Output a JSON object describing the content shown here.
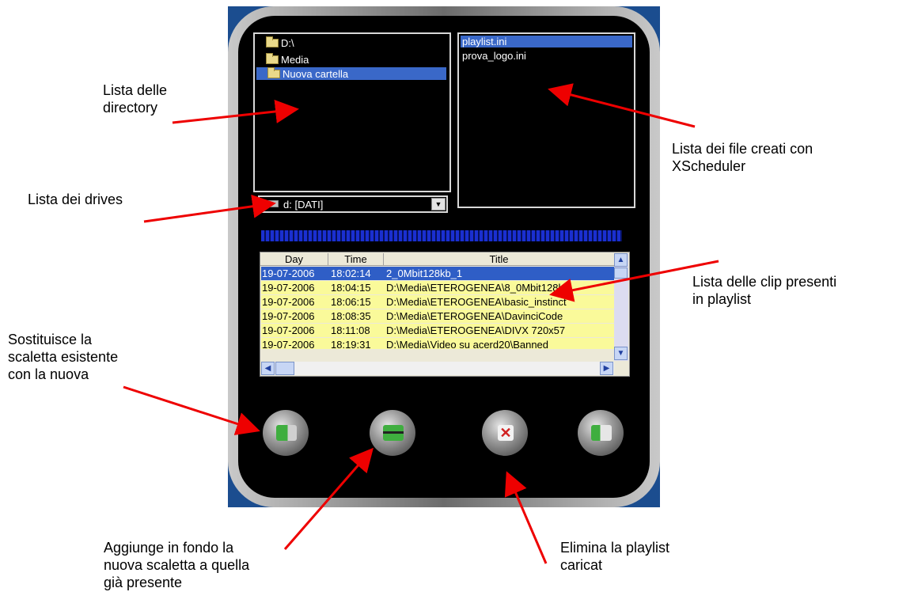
{
  "tree": {
    "items": [
      {
        "label": "D:\\",
        "selected": false
      },
      {
        "label": "Media",
        "selected": false
      },
      {
        "label": "Nuova cartella",
        "selected": true
      }
    ]
  },
  "files": {
    "items": [
      {
        "label": "playlist.ini",
        "selected": true
      },
      {
        "label": "prova_logo.ini",
        "selected": false
      }
    ]
  },
  "drive": {
    "value": "d: [DATI]"
  },
  "table": {
    "columns": [
      "Day",
      "Time",
      "Title"
    ],
    "rows": [
      [
        "19-07-2006",
        "18:02:14",
        "2_0Mbit128kb_1"
      ],
      [
        "19-07-2006",
        "18:04:15",
        "D:\\Media\\ETEROGENEA\\8_0Mbit128k"
      ],
      [
        "19-07-2006",
        "18:06:15",
        "D:\\Media\\ETEROGENEA\\basic_instinct"
      ],
      [
        "19-07-2006",
        "18:08:35",
        "D:\\Media\\ETEROGENEA\\DavinciCode"
      ],
      [
        "19-07-2006",
        "18:11:08",
        "D:\\Media\\ETEROGENEA\\DIVX 720x57"
      ],
      [
        "19-07-2006",
        "18:19:31",
        "D:\\Media\\Video su acerd20\\Banned"
      ]
    ],
    "selected_row": 0
  },
  "buttons": [
    {
      "name": "replace-playlist-button",
      "icon": "replace-icon"
    },
    {
      "name": "append-playlist-button",
      "icon": "append-icon"
    },
    {
      "name": "delete-playlist-button",
      "icon": "delete-icon"
    },
    {
      "name": "exit-button",
      "icon": "exit-icon"
    }
  ],
  "annotations": {
    "dir_list": [
      "Lista delle",
      "directory"
    ],
    "file_list": [
      "Lista dei file creati con",
      "XScheduler"
    ],
    "drives": "Lista dei drives",
    "clips": [
      "Lista delle clip presenti",
      "in playlist"
    ],
    "replace": [
      "Sostituisce la",
      "scaletta esistente",
      "con la nuova"
    ],
    "append": [
      "Aggiunge in fondo la",
      "nuova scaletta a quella",
      "già presente"
    ],
    "delete": [
      "Elimina la playlist",
      "caricat"
    ]
  },
  "colors": {
    "selection": "#3a68c8",
    "row_bg": "#fafa9a",
    "arrow": "#ee0000"
  }
}
